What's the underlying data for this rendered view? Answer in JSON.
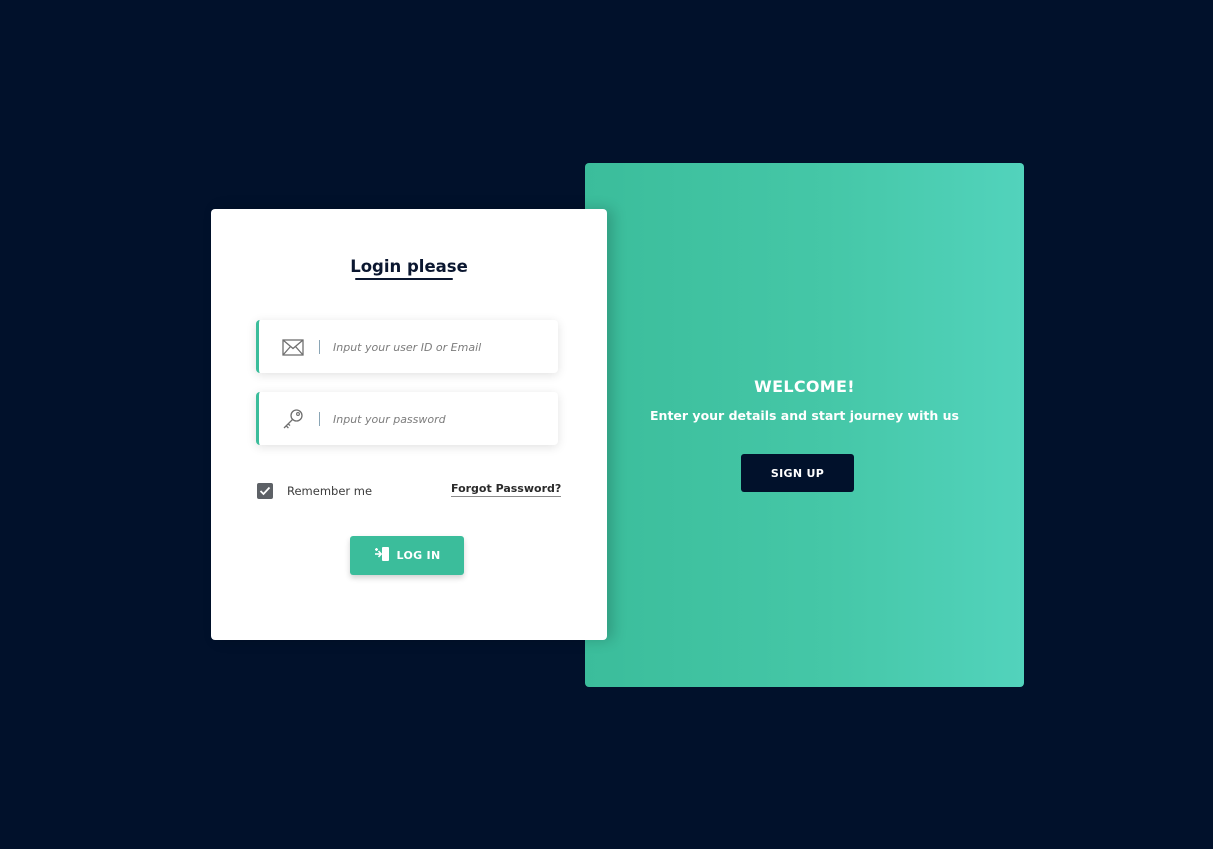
{
  "login": {
    "title": "Login please",
    "email_placeholder": "Input your user ID or Email",
    "password_placeholder": "Input your password",
    "remember_label": "Remember me",
    "remember_checked": true,
    "forgot_label": "Forgot Password?",
    "login_label": "LOG IN",
    "icons": {
      "email": "envelope-icon",
      "password": "key-icon",
      "login": "login-door-icon",
      "checkbox": "checkmark-icon"
    }
  },
  "welcome": {
    "title": "WELCOME!",
    "subtitle": "Enter your details and start journey with us",
    "signup_label": "SIGN UP"
  },
  "colors": {
    "background": "#01112b",
    "accent": "#3bbd9b",
    "card": "#ffffff",
    "dark_button": "#01112b"
  }
}
